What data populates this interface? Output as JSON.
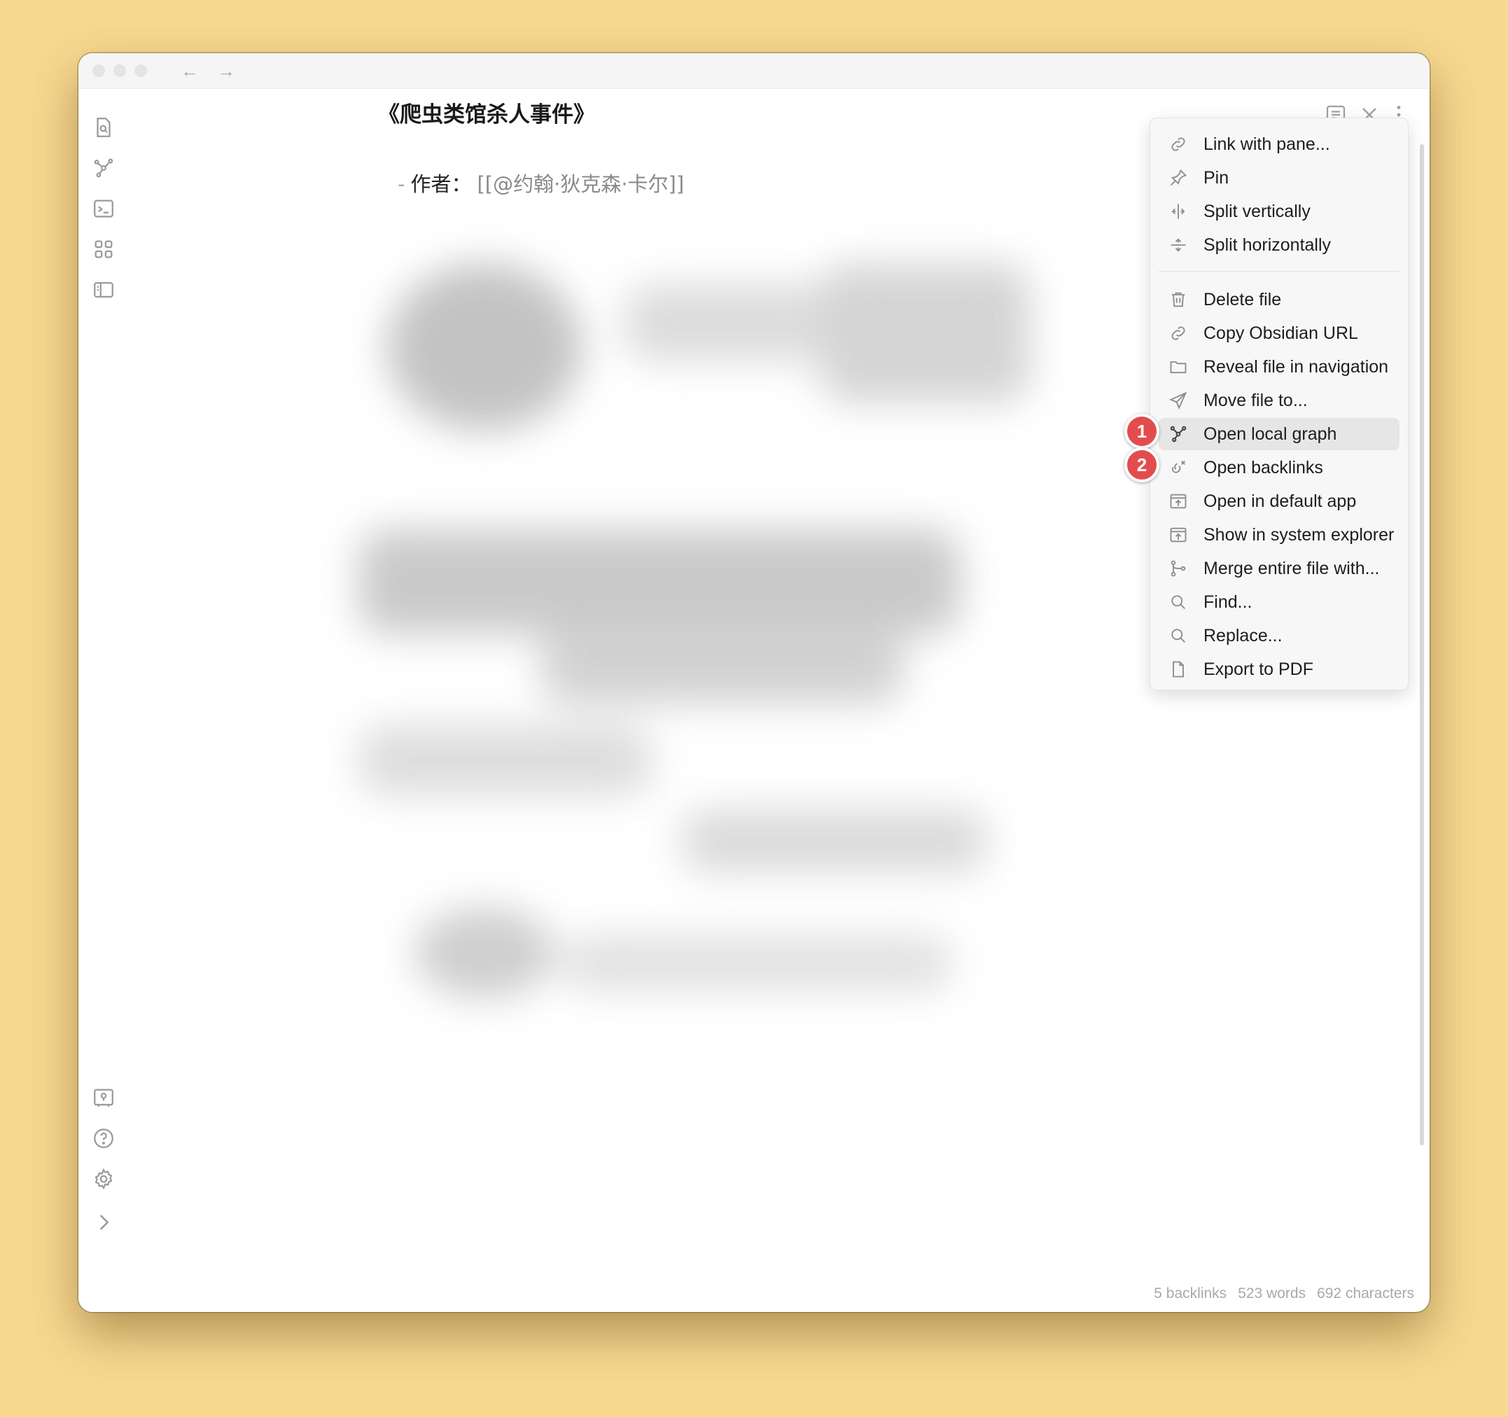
{
  "window": {
    "nav": {
      "back_icon": "arrow-left-icon",
      "forward_icon": "arrow-right-icon",
      "back_glyph": "←",
      "forward_glyph": "→"
    }
  },
  "ribbon": {
    "top_icons": [
      "search-doc-icon",
      "graph-icon",
      "terminal-icon",
      "grid-icon",
      "sidebar-icon"
    ],
    "bottom_icons": [
      "vault-icon",
      "help-icon",
      "settings-icon",
      "chevron-right-icon"
    ]
  },
  "document": {
    "title": "《爬虫类馆杀人事件》",
    "meta_dash": "-",
    "meta_key": "作者：",
    "meta_link": "[[@约翰·狄克森·卡尔]]"
  },
  "header_icons": [
    "reading-view-icon",
    "close-icon",
    "more-options-icon"
  ],
  "menu": {
    "items": [
      {
        "label": "Link with pane...",
        "icon": "link-icon"
      },
      {
        "label": "Pin",
        "icon": "pin-icon"
      },
      {
        "label": "Split vertically",
        "icon": "split-vertical-icon"
      },
      {
        "label": "Split horizontally",
        "icon": "split-horizontal-icon"
      },
      {
        "label": "Delete file",
        "icon": "trash-icon"
      },
      {
        "label": "Copy Obsidian URL",
        "icon": "link-icon"
      },
      {
        "label": "Reveal file in navigation",
        "icon": "folder-icon"
      },
      {
        "label": "Move file to...",
        "icon": "send-icon"
      },
      {
        "label": "Open local graph",
        "icon": "graph-icon"
      },
      {
        "label": "Open backlinks",
        "icon": "backlinks-icon"
      },
      {
        "label": "Open in default app",
        "icon": "open-external-icon"
      },
      {
        "label": "Show in system explorer",
        "icon": "open-external-icon"
      },
      {
        "label": "Merge entire file with...",
        "icon": "merge-icon"
      },
      {
        "label": "Find...",
        "icon": "search-icon"
      },
      {
        "label": "Replace...",
        "icon": "search-icon"
      },
      {
        "label": "Export to PDF",
        "icon": "file-icon"
      }
    ],
    "highlighted_item": "Open local graph"
  },
  "annotations": {
    "badge1": "1",
    "badge2": "2",
    "badge_color": "#e34c4c"
  },
  "status_bar": {
    "backlinks": "5 backlinks",
    "words": "523 words",
    "characters": "692 characters"
  },
  "colors": {
    "background": "#f8d990",
    "window": "#ffffff",
    "menu": "#f7f7f7"
  }
}
